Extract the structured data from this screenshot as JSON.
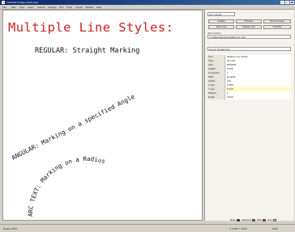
{
  "window": {
    "title": "CANVAS ProSign (draft view)"
  },
  "menu": [
    "File",
    "Edit",
    "View",
    "Insert",
    "Format",
    "Arrange",
    "Text",
    "Tools",
    "Layout",
    "Window",
    "Help"
  ],
  "canvas": {
    "title": "Multiple Line Styles:",
    "regular": "REGULAR: Straight Marking",
    "angular": "ANGULAR: Marking on a specified Angle",
    "arc": "ARC TEXT: Marking on a Radius",
    "text_color": "#cc2222"
  },
  "panel": {
    "top_field": "Art_Line 02",
    "buttons": [
      "Update",
      "Preview",
      "Print preview",
      "New Line",
      "Delete Line",
      "Transfer"
    ],
    "path_label": "Job Location",
    "path_value": "C:\\\\Data\\\\Samples\\\\Multi-Line.mkj",
    "style_select": "Line 2: Angular text",
    "properties": [
      {
        "name": "Text",
        "value": "Multiple Line Styles"
      },
      {
        "name": "Type",
        "value": "Normal"
      },
      {
        "name": "Font",
        "value": "ROMAN"
      },
      {
        "name": "Height",
        "value": "3.500"
      },
      {
        "name": "Compress",
        "value": "1"
      },
      {
        "name": "Slant",
        "value": "Regular"
      },
      {
        "name": "Justify",
        "value": "Left"
      },
      {
        "name": "X pos.",
        "value": "0.250"
      },
      {
        "name": "Y pos.",
        "value": "0.100",
        "highlight": true
      },
      {
        "name": "Passes",
        "value": "1"
      },
      {
        "name": "Depth",
        "value": "0.020"
      }
    ]
  },
  "legend": [
    {
      "label": "Ruler",
      "color": "#111111"
    },
    {
      "label": "Selection",
      "color": "#cc2222"
    },
    {
      "label": "Path",
      "color": "#cc2222"
    },
    {
      "label": "Grid",
      "color": "#ffffff"
    }
  ],
  "status": {
    "left": "Ready 100%",
    "mid": "X 0.000  Y 0.000",
    "right": "NUM"
  }
}
